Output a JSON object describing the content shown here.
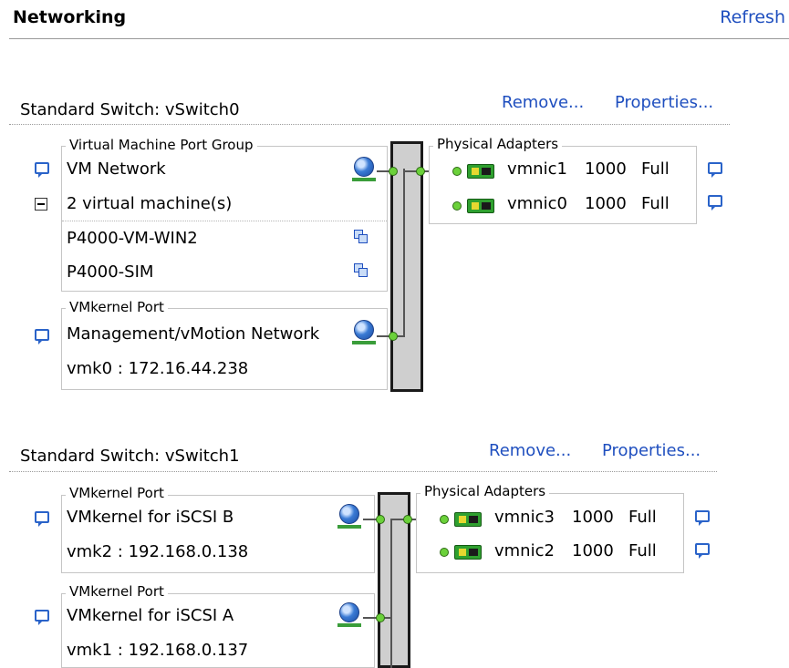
{
  "header": {
    "title": "Networking",
    "refresh": "Refresh"
  },
  "switches": [
    {
      "title": "Standard Switch: vSwitch0",
      "remove": "Remove...",
      "properties": "Properties...",
      "vm_port_group": {
        "legend": "Virtual Machine Port Group",
        "name": "VM Network",
        "vm_count": "2 virtual machine(s)",
        "vms": [
          "P4000-VM-WIN2",
          "P4000-SIM"
        ]
      },
      "vmkernel": {
        "legend": "VMkernel Port",
        "name": "Management/vMotion Network",
        "address": "vmk0 : 172.16.44.238"
      },
      "adapters": {
        "legend": "Physical Adapters",
        "items": [
          {
            "name": "vmnic1",
            "speed": "1000",
            "duplex": "Full"
          },
          {
            "name": "vmnic0",
            "speed": "1000",
            "duplex": "Full"
          }
        ]
      }
    },
    {
      "title": "Standard Switch: vSwitch1",
      "remove": "Remove...",
      "properties": "Properties...",
      "vmkernel_b": {
        "legend": "VMkernel Port",
        "name": "VMkernel for iSCSI B",
        "address": "vmk2 : 192.168.0.138"
      },
      "vmkernel_a": {
        "legend": "VMkernel Port",
        "name": "VMkernel for iSCSI A",
        "address": "vmk1 : 192.168.0.137"
      },
      "adapters": {
        "legend": "Physical Adapters",
        "items": [
          {
            "name": "vmnic3",
            "speed": "1000",
            "duplex": "Full"
          },
          {
            "name": "vmnic2",
            "speed": "1000",
            "duplex": "Full"
          }
        ]
      }
    }
  ]
}
